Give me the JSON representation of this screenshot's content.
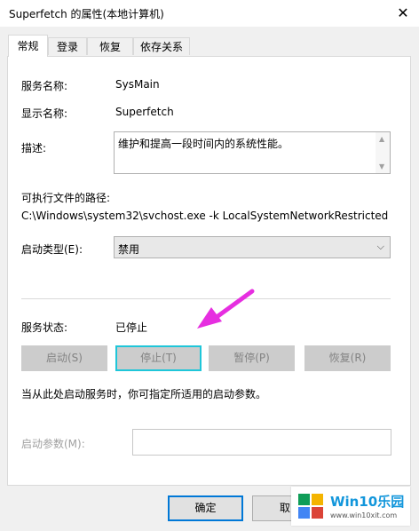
{
  "window": {
    "title": "Superfetch 的属性(本地计算机)",
    "close_glyph": "✕"
  },
  "tabs": [
    {
      "label": "常规",
      "active": true
    },
    {
      "label": "登录",
      "active": false
    },
    {
      "label": "恢复",
      "active": false
    },
    {
      "label": "依存关系",
      "active": false
    }
  ],
  "general": {
    "service_name_label": "服务名称:",
    "service_name_value": "SysMain",
    "display_name_label": "显示名称:",
    "display_name_value": "Superfetch",
    "description_label": "描述:",
    "description_value": "维护和提高一段时间内的系统性能。",
    "path_label": "可执行文件的路径:",
    "path_value": "C:\\Windows\\system32\\svchost.exe -k LocalSystemNetworkRestricted",
    "startup_type_label": "启动类型(E):",
    "startup_type_value": "禁用",
    "status_label": "服务状态:",
    "status_value": "已停止",
    "buttons": {
      "start": "启动(S)",
      "stop": "停止(T)",
      "pause": "暂停(P)",
      "resume": "恢复(R)"
    },
    "hint": "当从此处启动服务时，你可指定所适用的启动参数。",
    "params_label": "启动参数(M):",
    "params_value": ""
  },
  "footer": {
    "ok": "确定",
    "cancel_partial": "取"
  },
  "watermark": {
    "brand": "Win10乐园",
    "url": "www.win10xit.com"
  },
  "colors": {
    "highlight_box": "#1fc6d9",
    "arrow": "#e62ee0",
    "brand_blue": "#1296db"
  }
}
